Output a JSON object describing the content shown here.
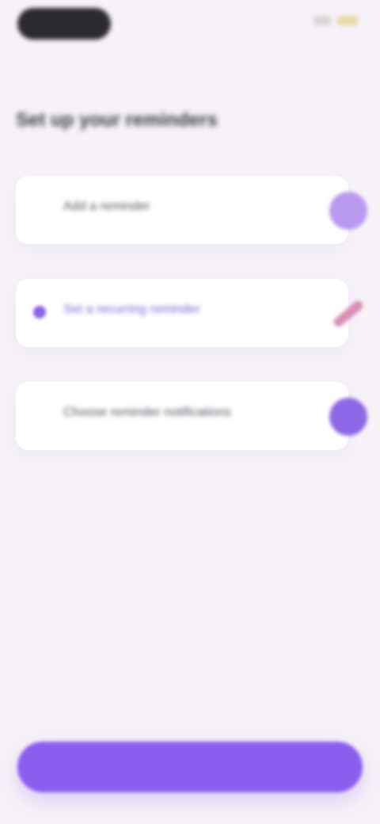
{
  "status_bar": {
    "time": "",
    "indicators": [
      "signal-icon",
      "battery-icon"
    ]
  },
  "page": {
    "title": "Set up your reminders"
  },
  "options": [
    {
      "label": "Add a reminder",
      "active": false,
      "action_icon": "pencil-icon"
    },
    {
      "label": "Set a recurring reminder",
      "active": true,
      "action_icon": "link-icon"
    },
    {
      "label": "Choose reminder notifications",
      "active": false,
      "action_icon": "check-icon"
    }
  ],
  "footer": {
    "button_label": ""
  },
  "colors": {
    "accent": "#8a5ff0",
    "background": "#f6f2f8",
    "card": "#ffffff",
    "title": "#3b3745"
  }
}
